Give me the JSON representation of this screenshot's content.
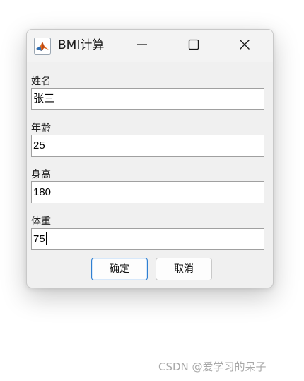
{
  "window": {
    "title": "BMI计算"
  },
  "titlebar": {
    "app_icon": "matlab-icon",
    "minimize_icon": "minimize-icon",
    "maximize_icon": "maximize-icon",
    "close_icon": "close-icon"
  },
  "form": {
    "fields": [
      {
        "label": "姓名",
        "value": "张三"
      },
      {
        "label": "年龄",
        "value": "25"
      },
      {
        "label": "身高",
        "value": "180"
      },
      {
        "label": "体重",
        "value": "75"
      }
    ],
    "ok_label": "确定",
    "cancel_label": "取消"
  },
  "watermark": {
    "text": "CSDN @爱学习的呆子"
  },
  "colors": {
    "window_bg": "#f0f0f0",
    "focus_border": "#2f7fd1",
    "input_border": "#a0a0a0"
  }
}
